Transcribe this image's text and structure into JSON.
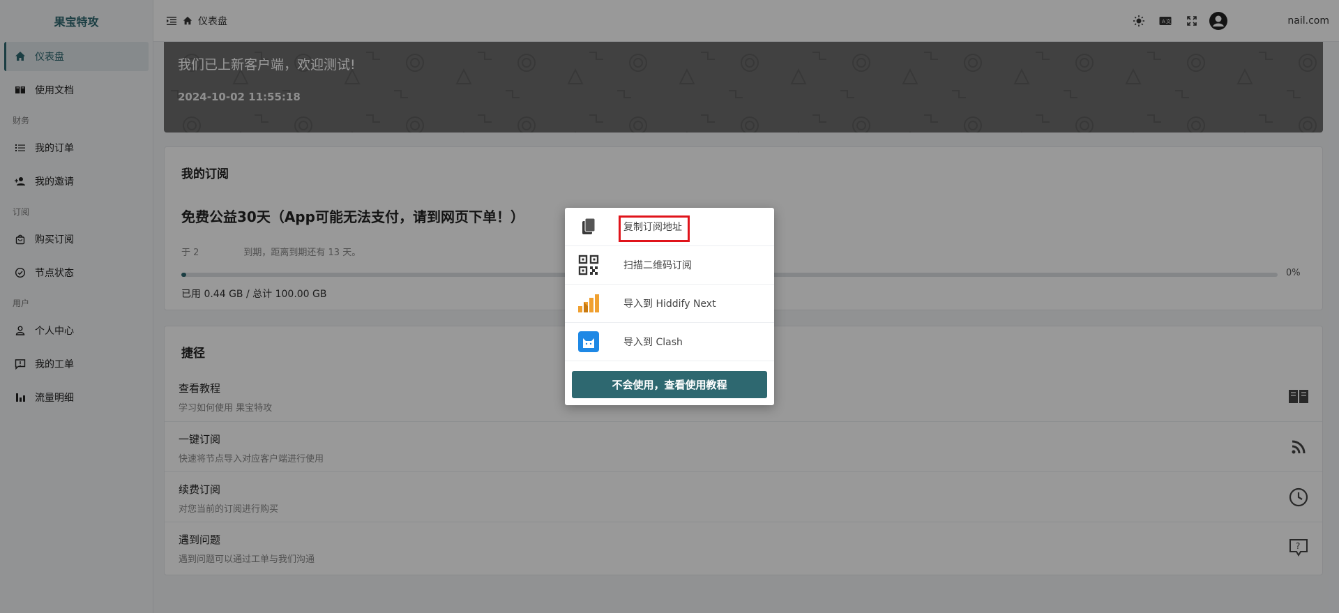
{
  "sidebar": {
    "brand": "果宝特攻",
    "items": [
      {
        "label": "仪表盘",
        "icon": "home-icon"
      },
      {
        "label": "使用文档",
        "icon": "book-icon"
      },
      {
        "label": "我的订单",
        "icon": "list-icon"
      },
      {
        "label": "我的邀请",
        "icon": "user-add-icon"
      },
      {
        "label": "购买订阅",
        "icon": "bag-icon"
      },
      {
        "label": "节点状态",
        "icon": "check-circle-icon"
      },
      {
        "label": "个人中心",
        "icon": "person-icon"
      },
      {
        "label": "我的工单",
        "icon": "chat-alert-icon"
      },
      {
        "label": "流量明细",
        "icon": "bar-chart-icon"
      }
    ],
    "groups": [
      "财务",
      "订阅",
      "用户"
    ]
  },
  "header": {
    "breadcrumb": "仪表盘",
    "email": "nail.com"
  },
  "banner": {
    "title": "我们已上新客户端，欢迎测试!",
    "time": "2024-10-02 11:55:18"
  },
  "subscription": {
    "section_title": "我的订阅",
    "plan_name": "免费公益30天（App可能无法支付，请到网页下单！）",
    "expire_prefix": "于 2",
    "expire_suffix": "到期，距离到期还有 13 天。",
    "progress": 0.0044,
    "progress_label": "0%",
    "usage": "已用 0.44 GB / 总计 100.00 GB"
  },
  "shortcuts": {
    "section_title": "捷径",
    "rows": [
      {
        "title": "查看教程",
        "desc": "学习如何使用 果宝特攻",
        "icon": "book-open-icon"
      },
      {
        "title": "一键订阅",
        "desc": "快速将节点导入对应客户端进行使用",
        "icon": "rss-icon"
      },
      {
        "title": "续费订阅",
        "desc": "对您当前的订阅进行购买",
        "icon": "clock-icon"
      },
      {
        "title": "遇到问题",
        "desc": "遇到问题可以通过工单与我们沟通",
        "icon": "help-chat-icon"
      }
    ]
  },
  "popup": {
    "items": [
      {
        "label": "复制订阅地址",
        "icon": "copy-icon"
      },
      {
        "label": "扫描二维码订阅",
        "icon": "qrcode-icon"
      },
      {
        "label": "导入到 Hiddify Next",
        "icon": "hiddify-icon"
      },
      {
        "label": "导入到 Clash",
        "icon": "clash-icon"
      }
    ],
    "button": "不会使用，查看使用教程"
  },
  "colors": {
    "accent": "#2e6870",
    "highlight": "#e0141b",
    "banner": "#6d6d6d"
  }
}
